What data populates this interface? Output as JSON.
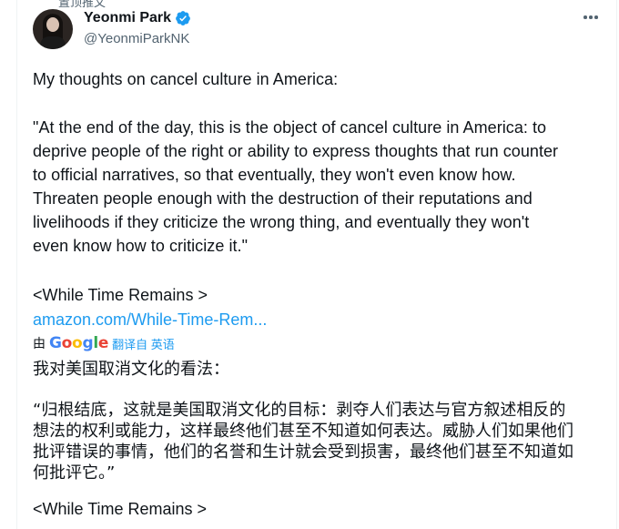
{
  "header": {
    "top_cut_text": "置顶推文"
  },
  "author": {
    "display_name": "Yeonmi Park",
    "handle": "@YeonmiParkNK",
    "verified_color": "#1d9bf0"
  },
  "tweet": {
    "line1": "My thoughts on cancel culture in America:",
    "quote": "\"At the end of the day, this is the object of cancel culture in America: to\ndeprive people of the right or ability to express thoughts that run counter\nto official narratives, so that eventually, they won't even know how.\nThreaten people enough with the destruction of their reputations and\nlivelihoods if they criticize the wrong thing, and eventually they won't\neven know how to criticize it.\"",
    "book_title": "<While Time Remains >",
    "link_text": "amazon.com/While-Time-Rem..."
  },
  "translation": {
    "by_label": "由",
    "google_word": [
      "G",
      "o",
      "o",
      "g",
      "l",
      "e"
    ],
    "translated_from": "翻译自 英语",
    "zh_title": "我对美国取消文化的看法：",
    "zh_quote": "“归根结底，这就是美国取消文化的目标：剥夺人们表达与官方叙述相反的\n想法的权利或能力，这样最终他们甚至不知道如何表达。威胁人们如果他们\n批评错误的事情，他们的名誉和生计就会受到损害，最终他们甚至不知道如\n何批评它。”",
    "zh_book_title": "<While Time Remains >"
  },
  "icons": {
    "more": "more-options-icon",
    "verified": "verified-badge-icon"
  },
  "colors": {
    "accent": "#1d9bf0",
    "secondary_text": "#536471",
    "primary_text": "#0f1419"
  }
}
